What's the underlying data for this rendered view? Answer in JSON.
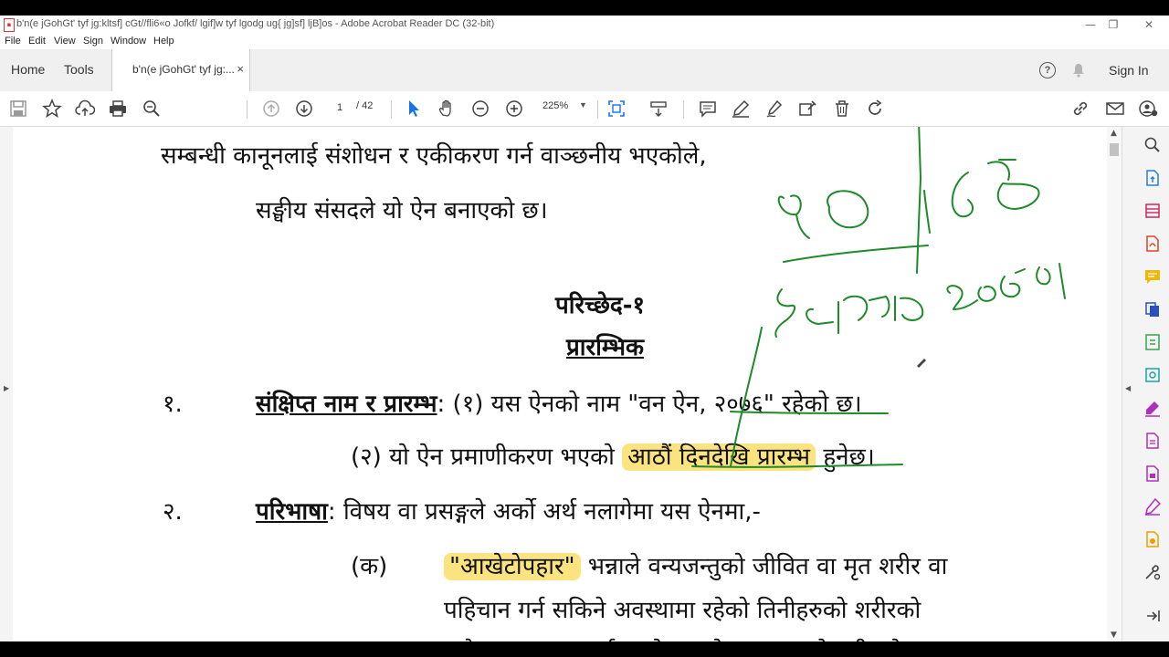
{
  "window": {
    "title": "b'n(e jGohGt' tyf jg:kltsf] cGt//fli6«o Jofkf/ lgif]w tyf lgodg ug{ jg]sf] ljB]os - Adobe Acrobat Reader DC (32-bit)",
    "minimize": "—",
    "restore": "❐",
    "close": "✕"
  },
  "menu": [
    "File",
    "Edit",
    "View",
    "Sign",
    "Window",
    "Help"
  ],
  "tabs": {
    "home": "Home",
    "tools": "Tools",
    "document": "b'n(e jGohGt' tyf jg:...",
    "close": "×"
  },
  "header_right": {
    "help": "?",
    "sign_in": "Sign In"
  },
  "toolbar": {
    "page_current": "1",
    "page_total": "/ 42",
    "zoom": "225%",
    "zoom_dropdown": "▼"
  },
  "document": {
    "line1": "सम्बन्धी कानूनलाई संशोधन र एकीकरण गर्न वाञ्छनीय भएकोले,",
    "line2": "सङ्घीय संसदले यो ऐन बनाएको छ।",
    "chapter": "परिच्छेद-१",
    "chapter_title": "प्रारम्भिक",
    "s1_num": "१.",
    "s1_heading": "संक्षिप्त नाम र प्रारम्भ",
    "s1_colon": ":",
    "s1_text_pre": " (१) यस ऐनको नाम \"",
    "s1_name": "वन ऐन, २०७६",
    "s1_text_post": "\" रहेको छ।",
    "s1_2_pre": "(२) यो ऐन प्रमाणीकरण भएको ",
    "s1_2_hl": "आठौं दिनदेखि प्रारम्भ",
    "s1_2_post": " हुनेछ।",
    "s2_num": "२.",
    "s2_heading": "परिभाषा",
    "s2_text": ": विषय वा प्रसङ्गले अर्को अर्थ नलागेमा यस ऐनमा,-",
    "ka_label": "(क)",
    "ka_term": "\"आखेटोपहार\"",
    "ka_text1": " भन्नाले वन्यजन्तुको जीवित वा मृत शरीर वा",
    "ka_text2": "पहिचान गर्न सकिने अवस्थामा रहेको तिनीहरुको शरीरको",
    "ka_text3": "कुनै अङ्ग सम्झनु पर्छ र सो शब्दले वन्यजन्तुको शरीरको"
  },
  "colors": {
    "highlight": "#fbe47f",
    "ink": "#1e8a2a",
    "accent_blue": "#1473e6"
  }
}
